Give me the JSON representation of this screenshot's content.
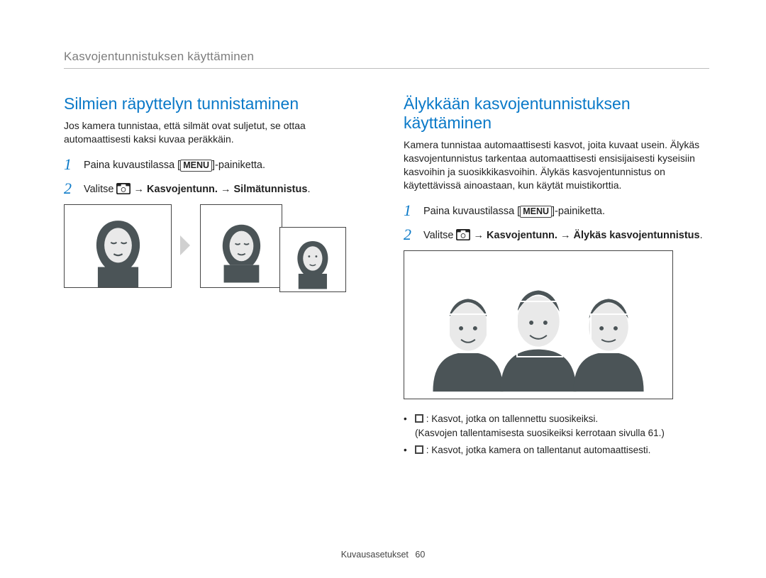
{
  "topbar": "Kasvojentunnistuksen käyttäminen",
  "left": {
    "heading": "Silmien räpyttelyn tunnistaminen",
    "intro": "Jos kamera tunnistaa, että silmät ovat suljetut, se ottaa automaattisesti kaksi kuvaa peräkkäin.",
    "step1_pre": "Paina kuvaustilassa [",
    "step1_menu": "MENU",
    "step1_post": "]-painiketta.",
    "step2_pre": "Valitse ",
    "step2_path_1": " → Kasvojentunn. → Silmätunnistus",
    "step2_end": "."
  },
  "right": {
    "heading": "Älykkään kasvojentunnistuksen käyttäminen",
    "intro": "Kamera tunnistaa automaattisesti kasvot, joita kuvaat usein. Älykäs kasvojentunnistus tarkentaa automaattisesti ensisijaisesti kyseisiin kasvoihin ja suosikkikasvoihin. Älykäs kasvojentunnistus on käytettävissä ainoastaan, kun käytät muistikorttia.",
    "step1_pre": "Paina kuvaustilassa [",
    "step1_menu": "MENU",
    "step1_post": "]-painiketta.",
    "step2_pre": "Valitse ",
    "step2_path_1": " → Kasvojentunn. → Älykäs kasvojentunnistus",
    "step2_end": ".",
    "bullet1_a": " : Kasvot, jotka on tallennettu suosikeiksi.",
    "bullet1_b": "(Kasvojen tallentamisesta suosikeiksi kerrotaan sivulla 61.)",
    "bullet2": " : Kasvot, jotka kamera on tallentanut automaattisesti."
  },
  "footer": {
    "section": "Kuvausasetukset",
    "page": "60"
  }
}
